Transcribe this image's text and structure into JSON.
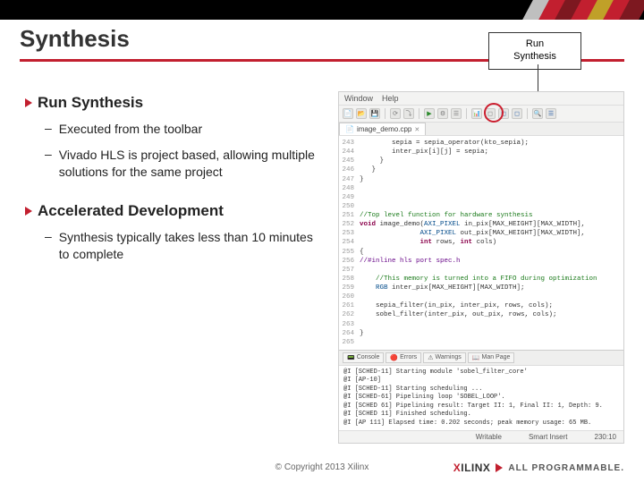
{
  "title": "Synthesis",
  "callout": {
    "line1": "Run",
    "line2": "Synthesis"
  },
  "sections": [
    {
      "heading": "Run Synthesis",
      "bullets": [
        "Executed from the toolbar",
        "Vivado HLS is project based, allowing multiple solutions for the same project"
      ]
    },
    {
      "heading": "Accelerated Development",
      "bullets": [
        "Synthesis typically takes less than 10 minutes to complete"
      ]
    }
  ],
  "ide": {
    "menu": [
      "Window",
      "Help"
    ],
    "toolbar_icons": [
      "📄",
      "📂",
      "💾",
      "|",
      "⟳",
      "⤵",
      "|",
      "▶",
      "⚙",
      "☰",
      "|",
      "📊",
      "◻",
      "◻",
      "◻",
      "|",
      "🔍",
      "☰"
    ],
    "tab": "image_demo.cpp",
    "gutter": [
      "243",
      "244",
      "245",
      "246",
      "247",
      "248",
      "249",
      "250",
      "251",
      "252",
      "253",
      "254",
      "255",
      "256",
      "257",
      "258",
      "259",
      "260",
      "261",
      "262",
      "263",
      "264",
      "265"
    ],
    "code": [
      "        sepia = sepia_operator(kto_sepia);",
      "        inter_pix[i][j] = sepia;",
      "     }",
      "   }",
      "}",
      "",
      "",
      "",
      "//Top level function for hardware synthesis",
      "void image_demo(AXI_PIXEL in_pix[MAX_HEIGHT][MAX_WIDTH],",
      "               AXI_PIXEL out_pix[MAX_HEIGHT][MAX_WIDTH],",
      "               int rows, int cols)",
      "{",
      "//#inline hls port spec.h",
      "",
      "    //This memory is turned into a FIFO during optimization",
      "    RGB inter_pix[MAX_HEIGHT][MAX_WIDTH];",
      "",
      "    sepia_filter(in_pix, inter_pix, rows, cols);",
      "    sobel_filter(inter_pix, out_pix, rows, cols);",
      "",
      "}",
      ""
    ],
    "panel_tabs": [
      {
        "ic": "📟",
        "t": "Console"
      },
      {
        "ic": "🔴",
        "t": "Errors"
      },
      {
        "ic": "⚠",
        "t": "Warnings"
      },
      {
        "ic": "📖",
        "t": "Man Page"
      }
    ],
    "console": [
      "@I [SCHED-11] Starting module 'sobel_filter_core'",
      "@I [AP-10]",
      "@I [SCHED-11] Starting scheduling ...",
      "@I [SCHED-61] Pipelining loop 'SOBEL_LOOP'.",
      "@I [SCHED 61] Pipelining result: Target II: 1, Final II: 1, Depth: 9.",
      "@I [SCHED 11] Finished scheduling.",
      "@I [AP 111] Elapsed time: 0.202 seconds; peak memory usage: 65 MB."
    ],
    "status": {
      "mode": "Writable",
      "ins": "Smart Insert",
      "pos": "230:10"
    }
  },
  "footer": "© Copyright 2013 Xilinx",
  "brand": {
    "x": "XILINX",
    "tag": "ALL PROGRAMMABLE."
  }
}
